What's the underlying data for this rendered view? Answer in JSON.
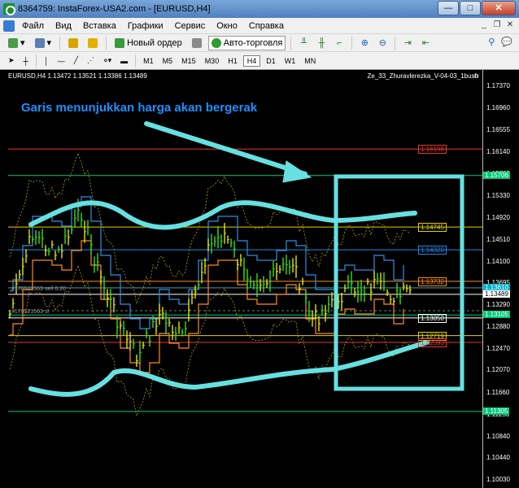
{
  "window": {
    "title": "8364759: InstaForex-USA2.com - [EURUSD,H4]",
    "buttons": {
      "minimize": "—",
      "maximize": "□",
      "close": "✕"
    }
  },
  "menu": [
    "Файл",
    "Вид",
    "Вставка",
    "Графики",
    "Сервис",
    "Окно",
    "Справка"
  ],
  "toolbar": {
    "new_order": "Новый ордер",
    "auto_trading": "Авто-торговля"
  },
  "timeframes": [
    "M1",
    "M5",
    "M15",
    "M30",
    "H1",
    "H4",
    "D1",
    "W1",
    "MN"
  ],
  "active_timeframe": "H4",
  "chart": {
    "header": "EURUSD,H4  1.13472 1.13521 1.13386 1.13489",
    "ea_label": "Ze_33_Zhuravlerezka_V-04-03_1bush",
    "annotation": "Garis menunjukkan harga akan bergerak",
    "annotation_color": "#1e90ff",
    "highlight_color": "#66e0e0",
    "order_labels": [
      "#170521563 sell 0.20",
      "#170521563 sl"
    ],
    "price_ticks": [
      "1.17370",
      "1.16960",
      "1.16555",
      "1.16140",
      "1.15735",
      "1.15330",
      "1.14920",
      "1.14510",
      "1.14100",
      "1.13695",
      "1.13290",
      "1.12880",
      "1.12470",
      "1.12070",
      "1.11660",
      "1.11250",
      "1.10840",
      "1.10440",
      "1.10030"
    ],
    "level_tags": [
      {
        "text": "1.16198",
        "bg": "#e53935",
        "fg": "#ffffff"
      },
      {
        "text": "1.15706",
        "bg": "#00c97a",
        "fg": "#ffffff"
      },
      {
        "text": "1.14745",
        "bg": "#e6d100",
        "fg": "#000000"
      },
      {
        "text": "1.14320",
        "bg": "#1e88e5",
        "fg": "#ffffff"
      },
      {
        "text": "1.13732",
        "bg": "#ff8c1a",
        "fg": "#000000"
      },
      {
        "text": "1.13610",
        "bg": "#00b0c8",
        "fg": "#ffffff"
      },
      {
        "text": "1.13489",
        "bg": "#ffffff",
        "fg": "#000000"
      },
      {
        "text": "1.13105",
        "bg": "#00c97a",
        "fg": "#ffffff"
      },
      {
        "text": "1.13050",
        "bg": "#ffffff",
        "fg": "#000000"
      },
      {
        "text": "1.12719",
        "bg": "#e6d100",
        "fg": "#000000"
      },
      {
        "text": "1.12593",
        "bg": "#e53935",
        "fg": "#ffffff"
      },
      {
        "text": "1.11305",
        "bg": "#00c97a",
        "fg": "#ffffff"
      }
    ]
  }
}
